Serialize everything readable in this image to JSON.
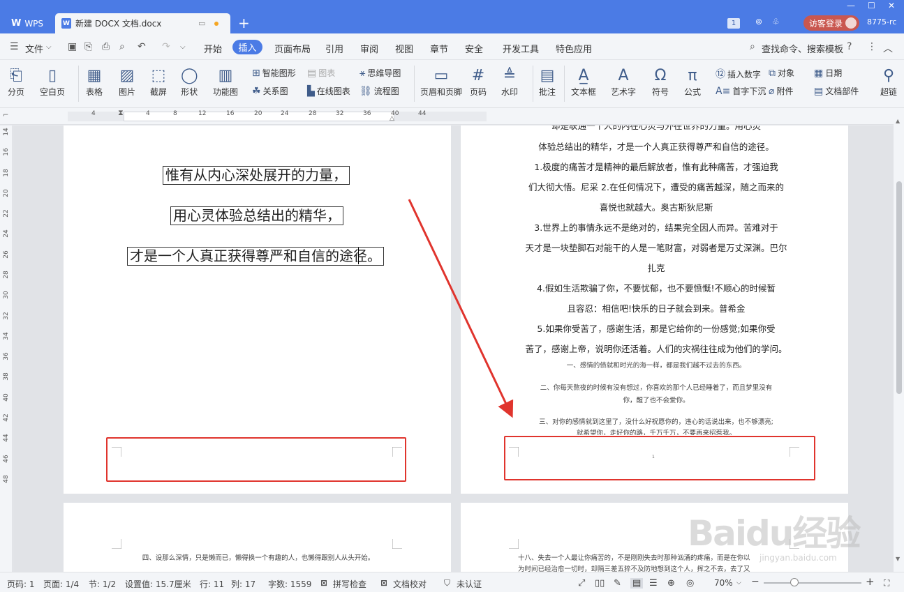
{
  "titlebar": {
    "wps_label": "WPS",
    "doc_tab": "新建 DOCX 文档.docx",
    "badge": "1",
    "login": "访客登录",
    "account": "8775-rc"
  },
  "menu": {
    "file": "文件",
    "items": [
      "开始",
      "插入",
      "页面布局",
      "引用",
      "审阅",
      "视图",
      "章节",
      "安全",
      "开发工具",
      "特色应用"
    ],
    "search": "查找命令、搜索模板"
  },
  "ribbon": {
    "page_break": "分页",
    "blank_page": "空白页",
    "table": "表格",
    "picture": "图片",
    "screenshot": "截屏",
    "shape": "形状",
    "func_chart": "功能图",
    "smart_shape": "智能图形",
    "chart": "图表",
    "mindmap": "思维导图",
    "relation": "关系图",
    "online_chart": "在线图表",
    "flowchart": "流程图",
    "header_footer": "页眉和页脚",
    "page_num": "页码",
    "watermark": "水印",
    "comment": "批注",
    "textbox": "文本框",
    "wordart": "艺术字",
    "symbol": "符号",
    "formula": "公式",
    "insert_num": "插入数字",
    "object": "对象",
    "date": "日期",
    "dropcap": "首字下沉",
    "attachment": "附件",
    "doc_parts": "文档部件",
    "hyperlink": "超链"
  },
  "ruler": {
    "h": [
      "4",
      "4",
      "8",
      "12",
      "16",
      "20",
      "24",
      "28",
      "32",
      "36",
      "40",
      "44"
    ],
    "v": [
      "14",
      "16",
      "18",
      "20",
      "22",
      "24",
      "26",
      "28",
      "30",
      "32",
      "34",
      "36",
      "38",
      "40",
      "42",
      "44",
      "46",
      "48"
    ]
  },
  "page1": {
    "lines": [
      "惟有从内心深处展开的力量，",
      "用心灵体验总结出的精华，",
      "才是一个人真正获得尊严和自信的途径。"
    ]
  },
  "page2": {
    "lines": [
      "体验总结出的精华，才是一个人真正获得尊严和自信的途径。",
      "1.极度的痛苦才是精神的最后解放者，惟有此种痛苦，才强迫我",
      "们大彻大悟。尼采 2.在任何情况下，遭受的痛苦越深，随之而来的",
      "喜悦也就越大。奥古斯狄尼斯",
      "3.世界上的事情永远不是绝对的，结果完全因人而异。苦难对于",
      "天才是一块垫脚石对能干的人是一笔财富，对弱者是万丈深渊。巴尔",
      "扎克",
      "4.假如生活欺骗了你，不要忧郁，也不要愤慨!不顺心的时候暂",
      "且容忍：相信吧!快乐的日子就会到来。普希金",
      "5.如果你受苦了，感谢生活，那是它给你的一份感觉;如果你受",
      "苦了，感谢上帝，说明你还活着。人们的灾祸往往成为他们的学问。"
    ],
    "small": [
      "一、感情的债就和时光的海一样，都是我们越不过去的东西。",
      "二、你每天熬夜的时候有没有想过，你喜欢的那个人已经睡着了，而且梦里没有",
      "你，醒了也不会爱你。",
      "三、对你的感情就到这里了，没什么好祝愿你的，违心的话说出来，也不够漂亮;",
      "就希望你，走好你的路，千万千万，不要再来招惹我。"
    ],
    "page_num": "1"
  },
  "page3": {
    "line": "四、设那么深情，只是懒而已，懒得换一个有趣的人，也懒得跟别人从头开始。"
  },
  "page4": {
    "lines": [
      "十八、失去一个人最让你痛苦的，不是刚刚失去时那种汹涌的疼痛，而是在你以",
      "为时间已经治愈一切时，却隔三差五猝不及防地想到这个人，挥之不去，去了又"
    ]
  },
  "watermark": {
    "text": "Baidu经验",
    "url": "jingyan.baidu.com"
  },
  "status": {
    "page": "页码: 1",
    "pages": "页面: 1/4",
    "section": "节: 1/2",
    "setting": "设置值: 15.7厘米",
    "row": "行: 11",
    "col": "列: 17",
    "words": "字数: 1559",
    "spell": "拼写检查",
    "proof": "文档校对",
    "cert": "未认证",
    "zoom": "70%"
  }
}
